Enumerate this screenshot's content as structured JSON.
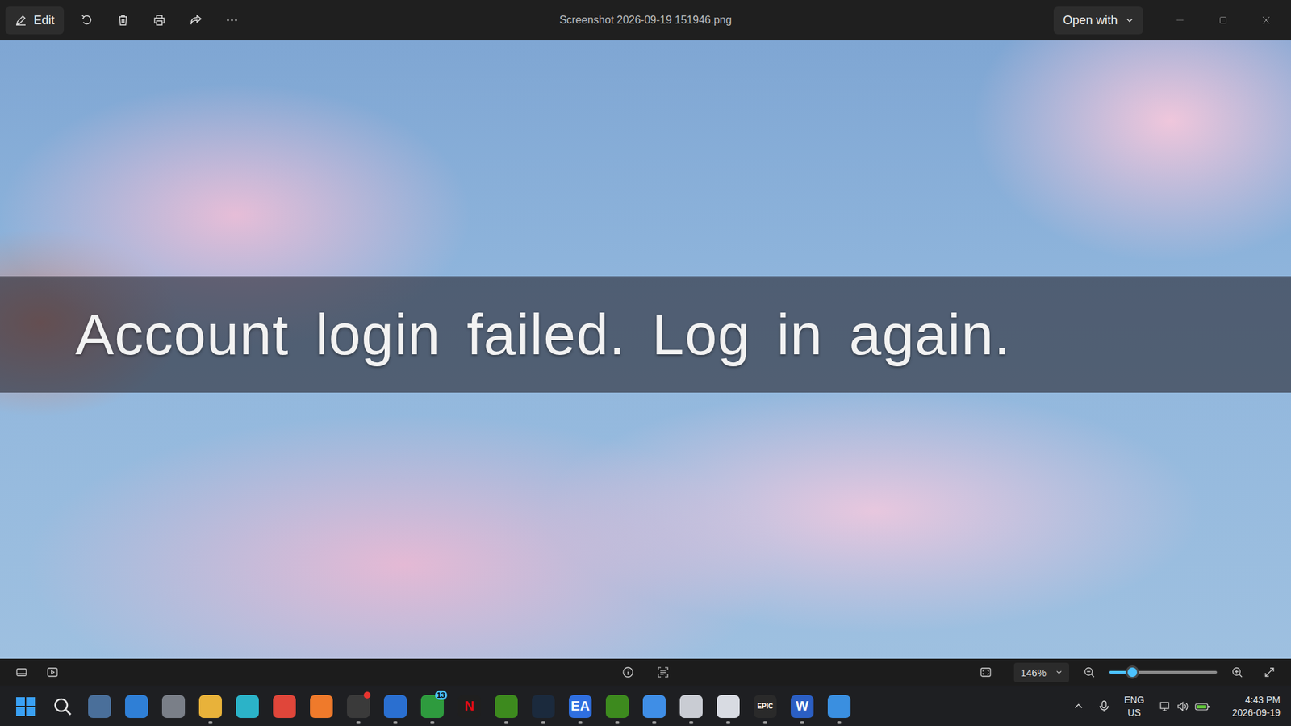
{
  "window": {
    "title": "Screenshot 2026-09-19 151946.png"
  },
  "toolbar": {
    "edit_label": "Edit",
    "open_with": "Open with"
  },
  "image": {
    "banner": "Account login failed. Log in again."
  },
  "zoom": {
    "value": "146%",
    "level": 0.21
  },
  "taskbar": {
    "apps": [
      {
        "kind": "start",
        "running": false,
        "notify": false,
        "color": "#3aa0f3"
      },
      {
        "kind": "search",
        "running": false,
        "notify": false,
        "color": "#e6e6e6"
      },
      {
        "kind": "app",
        "running": false,
        "notify": false,
        "color": "#4a6f9a"
      },
      {
        "kind": "app",
        "running": false,
        "notify": false,
        "color": "#2f7fd6"
      },
      {
        "kind": "app",
        "running": false,
        "notify": false,
        "color": "#7a7f88"
      },
      {
        "kind": "app",
        "running": true,
        "notify": false,
        "color": "#e8b23a"
      },
      {
        "kind": "app",
        "running": false,
        "notify": false,
        "color": "#2bb3c8"
      },
      {
        "kind": "app",
        "running": false,
        "notify": false,
        "color": "#e0463a"
      },
      {
        "kind": "app",
        "running": false,
        "notify": false,
        "color": "#ef7a2b"
      },
      {
        "kind": "app",
        "running": true,
        "notify": true,
        "color": "#3a3a3a"
      },
      {
        "kind": "app",
        "running": true,
        "notify": false,
        "color": "#2a6fd0"
      },
      {
        "kind": "app",
        "running": true,
        "notify": false,
        "color": "#2e9b3e",
        "badge": "13"
      },
      {
        "kind": "app",
        "running": false,
        "notify": false,
        "color": "#1f1f1f",
        "glyph": "N",
        "glyph_color": "#e50914"
      },
      {
        "kind": "app",
        "running": true,
        "notify": false,
        "color": "#3d8a1e"
      },
      {
        "kind": "app",
        "running": true,
        "notify": false,
        "color": "#1b2a3d"
      },
      {
        "kind": "app",
        "running": true,
        "notify": false,
        "color": "#2f6fe0",
        "glyph": "EA",
        "glyph_color": "#ffffff"
      },
      {
        "kind": "app",
        "running": true,
        "notify": false,
        "color": "#3d8a1e"
      },
      {
        "kind": "app",
        "running": true,
        "notify": false,
        "color": "#3f8ee6"
      },
      {
        "kind": "app",
        "running": true,
        "notify": false,
        "color": "#c9ccd3"
      },
      {
        "kind": "app",
        "running": true,
        "notify": false,
        "color": "#d8dbe2"
      },
      {
        "kind": "app",
        "running": true,
        "notify": false,
        "color": "#2a2a2a",
        "glyph": "EPIC",
        "glyph_color": "#ffffff"
      },
      {
        "kind": "app",
        "running": true,
        "notify": false,
        "color": "#2b5fc4",
        "glyph": "W",
        "glyph_color": "#ffffff"
      },
      {
        "kind": "app",
        "running": true,
        "notify": false,
        "color": "#3a8fe0"
      }
    ],
    "tray": {
      "language": "ENG",
      "region": "US",
      "time": "4:43 PM",
      "date": "2026-09-19"
    }
  }
}
